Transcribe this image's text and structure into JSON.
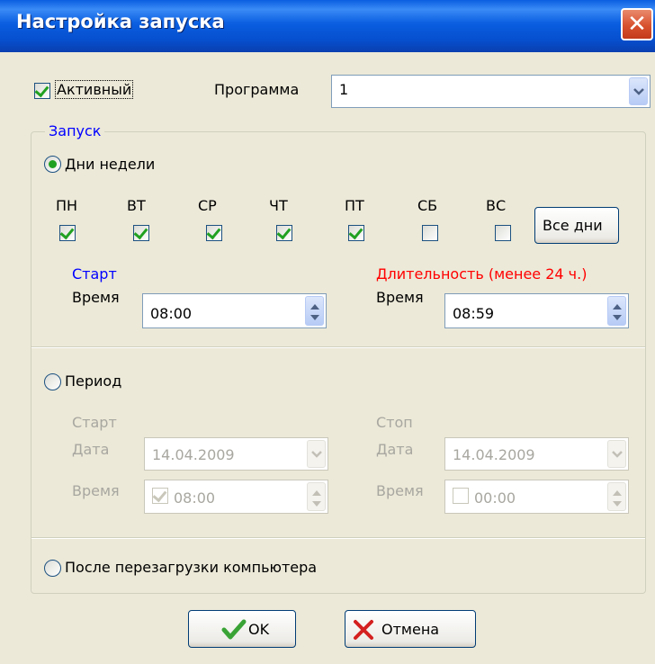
{
  "window": {
    "title": "Настройка запуска",
    "close_glyph": "✕"
  },
  "active": {
    "label": "Активный",
    "checked": true
  },
  "program": {
    "label": "Программа",
    "value": "1"
  },
  "launch_group": {
    "label": "Запуск"
  },
  "weekdays_mode": {
    "label": "Дни недели",
    "selected": true,
    "days": [
      {
        "label": "ПН",
        "checked": true
      },
      {
        "label": "ВТ",
        "checked": true
      },
      {
        "label": "СР",
        "checked": true
      },
      {
        "label": "ЧТ",
        "checked": true
      },
      {
        "label": "ПТ",
        "checked": true
      },
      {
        "label": "СБ",
        "checked": false
      },
      {
        "label": "ВС",
        "checked": false
      }
    ],
    "all_days_button": "Все дни",
    "start_heading": "Старт",
    "start_time_label": "Время",
    "start_time": "08:00",
    "duration_heading": "Длительность (менее 24 ч.)",
    "duration_time_label": "Время",
    "duration_time": "08:59"
  },
  "period_mode": {
    "label": "Период",
    "selected": false,
    "start_heading": "Старт",
    "start_date_label": "Дата",
    "start_date": "14.04.2009",
    "start_time_label": "Время",
    "start_time": "08:00",
    "start_time_checked": true,
    "stop_heading": "Стоп",
    "stop_date_label": "Дата",
    "stop_date": "14.04.2009",
    "stop_time_label": "Время",
    "stop_time": "00:00",
    "stop_time_checked": false
  },
  "reboot_mode": {
    "label": "После перезагрузки компьютера",
    "selected": false
  },
  "buttons": {
    "ok": "OK",
    "cancel": "Отмена"
  },
  "colors": {
    "start_heading": "#0000ff",
    "duration_heading": "#ff0000",
    "check": "#21a121",
    "title_bar": "#0a5ee0"
  },
  "icons": {
    "ok": "checkmark-icon",
    "cancel": "x-icon",
    "dropdown": "chevron-down-icon",
    "spinner": "up-down-arrows-icon"
  }
}
